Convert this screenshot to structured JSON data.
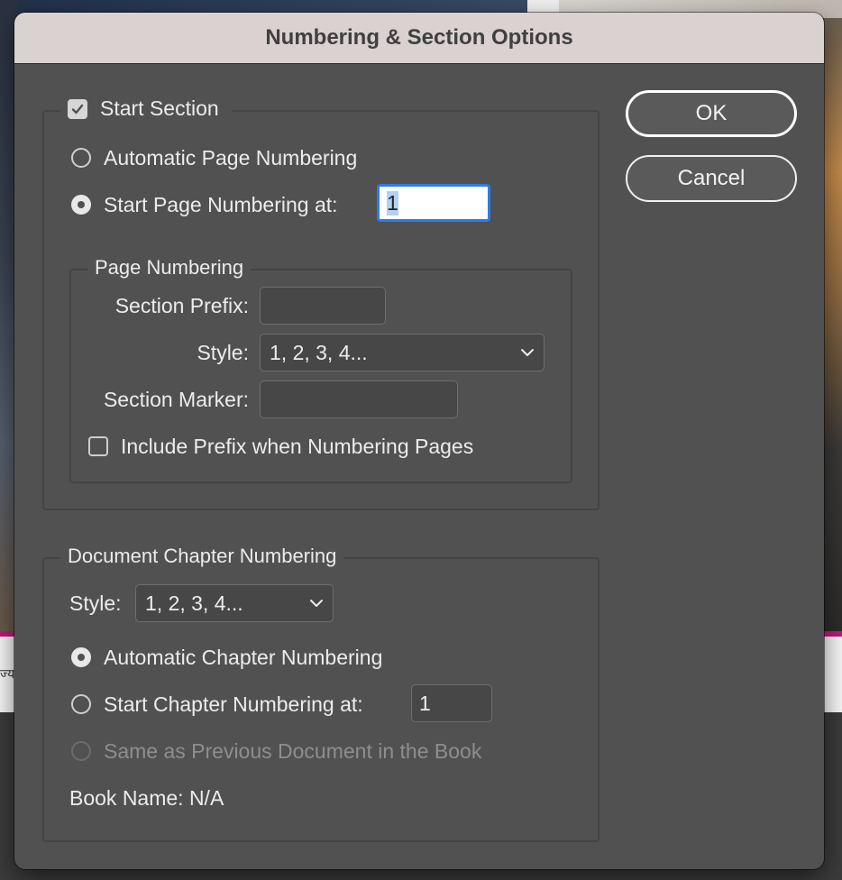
{
  "dialog": {
    "title": "Numbering & Section Options"
  },
  "background": {
    "strip_text": "ज्यारि"
  },
  "section": {
    "start_section_label": "Start Section",
    "start_section_checked": true,
    "automatic_page_numbering_label": "Automatic Page Numbering",
    "start_page_numbering_label": "Start Page Numbering at:",
    "start_page_value": "1"
  },
  "page_numbering": {
    "group_label": "Page Numbering",
    "section_prefix_label": "Section Prefix:",
    "section_prefix_value": "",
    "style_label": "Style:",
    "style_value": "1, 2, 3, 4...",
    "section_marker_label": "Section Marker:",
    "section_marker_value": "",
    "include_prefix_label": "Include Prefix when Numbering Pages",
    "include_prefix_checked": false
  },
  "chapter_numbering": {
    "group_label": "Document Chapter Numbering",
    "style_label": "Style:",
    "style_value": "1, 2, 3, 4...",
    "automatic_label": "Automatic Chapter Numbering",
    "start_label": "Start Chapter Numbering at:",
    "start_value": "1",
    "same_as_previous_label": "Same as Previous Document in the Book",
    "book_name_label": "Book Name: N/A"
  },
  "buttons": {
    "ok": "OK",
    "cancel": "Cancel"
  },
  "colors": {
    "dialog_bg": "#515151",
    "titlebar_bg": "#dad1d1",
    "focus_ring": "#2e7ce6"
  },
  "icons": [
    "checkmark-icon",
    "chevron-down-icon"
  ]
}
